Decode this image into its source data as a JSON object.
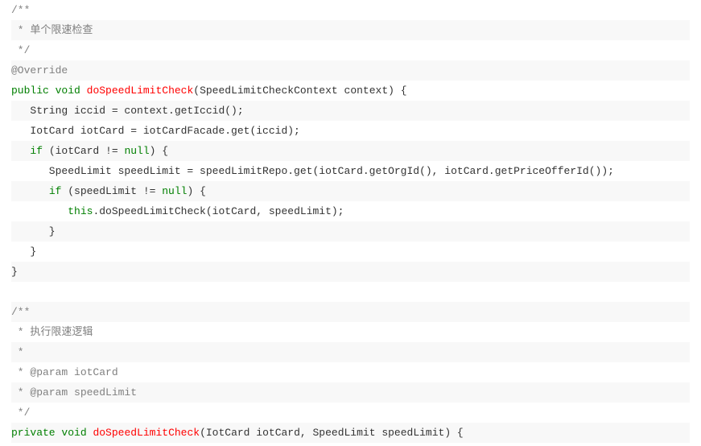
{
  "lines": [
    {
      "alt": false,
      "tokens": [
        {
          "cls": "comment",
          "text": "/**"
        }
      ]
    },
    {
      "alt": true,
      "tokens": [
        {
          "cls": "comment",
          "text": " * 单个限速检查"
        }
      ]
    },
    {
      "alt": false,
      "tokens": [
        {
          "cls": "comment",
          "text": " */"
        }
      ]
    },
    {
      "alt": true,
      "tokens": [
        {
          "cls": "annotation",
          "text": "@Override"
        }
      ]
    },
    {
      "alt": false,
      "tokens": [
        {
          "cls": "keyword",
          "text": "public"
        },
        {
          "cls": "plain",
          "text": " "
        },
        {
          "cls": "keyword",
          "text": "void"
        },
        {
          "cls": "plain",
          "text": " "
        },
        {
          "cls": "method-name",
          "text": "doSpeedLimitCheck"
        },
        {
          "cls": "plain",
          "text": "(SpeedLimitCheckContext context) {"
        }
      ]
    },
    {
      "alt": true,
      "tokens": [
        {
          "cls": "plain",
          "text": "   String iccid = context.getIccid();"
        }
      ]
    },
    {
      "alt": false,
      "tokens": [
        {
          "cls": "plain",
          "text": "   IotCard iotCard = iotCardFacade.get(iccid);"
        }
      ]
    },
    {
      "alt": true,
      "tokens": [
        {
          "cls": "plain",
          "text": "   "
        },
        {
          "cls": "keyword",
          "text": "if"
        },
        {
          "cls": "plain",
          "text": " (iotCard != "
        },
        {
          "cls": "keyword",
          "text": "null"
        },
        {
          "cls": "plain",
          "text": ") {"
        }
      ]
    },
    {
      "alt": false,
      "tokens": [
        {
          "cls": "plain",
          "text": "      SpeedLimit speedLimit = speedLimitRepo.get(iotCard.getOrgId(), iotCard.getPriceOfferId());"
        }
      ]
    },
    {
      "alt": true,
      "tokens": [
        {
          "cls": "plain",
          "text": "      "
        },
        {
          "cls": "keyword",
          "text": "if"
        },
        {
          "cls": "plain",
          "text": " (speedLimit != "
        },
        {
          "cls": "keyword",
          "text": "null"
        },
        {
          "cls": "plain",
          "text": ") {"
        }
      ]
    },
    {
      "alt": false,
      "tokens": [
        {
          "cls": "plain",
          "text": "         "
        },
        {
          "cls": "keyword",
          "text": "this"
        },
        {
          "cls": "plain",
          "text": ".doSpeedLimitCheck(iotCard, speedLimit);"
        }
      ]
    },
    {
      "alt": true,
      "tokens": [
        {
          "cls": "plain",
          "text": "      }"
        }
      ]
    },
    {
      "alt": false,
      "tokens": [
        {
          "cls": "plain",
          "text": "   }"
        }
      ]
    },
    {
      "alt": true,
      "tokens": [
        {
          "cls": "plain",
          "text": "}"
        }
      ]
    },
    {
      "alt": false,
      "tokens": [
        {
          "cls": "plain",
          "text": " "
        }
      ]
    },
    {
      "alt": true,
      "tokens": [
        {
          "cls": "comment",
          "text": "/**"
        }
      ]
    },
    {
      "alt": false,
      "tokens": [
        {
          "cls": "comment",
          "text": " * 执行限速逻辑"
        }
      ]
    },
    {
      "alt": true,
      "tokens": [
        {
          "cls": "comment",
          "text": " *"
        }
      ]
    },
    {
      "alt": false,
      "tokens": [
        {
          "cls": "comment",
          "text": " * @param iotCard"
        }
      ]
    },
    {
      "alt": true,
      "tokens": [
        {
          "cls": "comment",
          "text": " * @param speedLimit"
        }
      ]
    },
    {
      "alt": false,
      "tokens": [
        {
          "cls": "comment",
          "text": " */"
        }
      ]
    },
    {
      "alt": true,
      "tokens": [
        {
          "cls": "keyword",
          "text": "private"
        },
        {
          "cls": "plain",
          "text": " "
        },
        {
          "cls": "keyword",
          "text": "void"
        },
        {
          "cls": "plain",
          "text": " "
        },
        {
          "cls": "method-name",
          "text": "doSpeedLimitCheck"
        },
        {
          "cls": "plain",
          "text": "(IotCard iotCard, SpeedLimit speedLimit) {"
        }
      ]
    }
  ]
}
